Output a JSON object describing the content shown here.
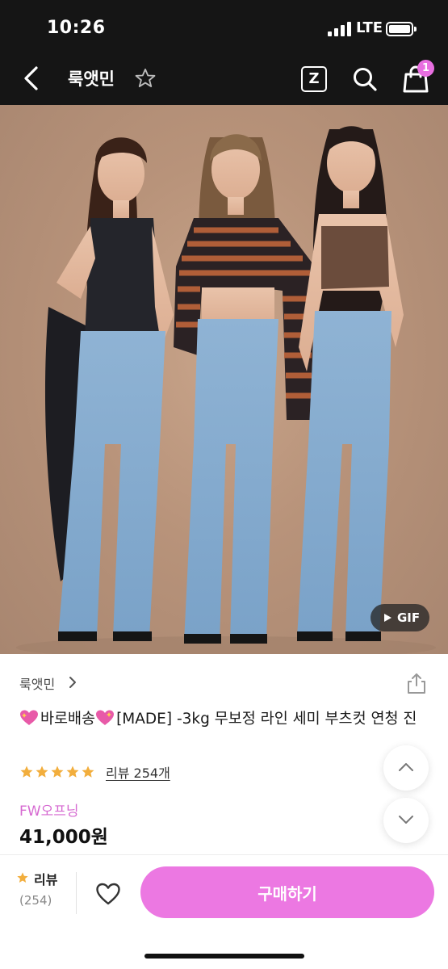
{
  "status_bar": {
    "time": "10:26",
    "network": "LTE",
    "icons": [
      "signal-icon",
      "battery-icon"
    ]
  },
  "header": {
    "back_icon": "chevron-left-icon",
    "title": "룩앳민",
    "favorite_icon": "star-outline-icon",
    "z_label": "Z",
    "search_icon": "search-icon",
    "cart_icon": "shopping-bag-icon",
    "cart_count": "1"
  },
  "product_image": {
    "gif_label": "GIF"
  },
  "product": {
    "brand": "룩앳민",
    "title_shipping": "바로배송",
    "title_rest": "[MADE] -3kg 무보정 라인 세미 부츠컷 연청 진",
    "rating_stars": 5,
    "review_link": "리뷰 254개",
    "promo": "FW오프닝",
    "price": "41,000원"
  },
  "bottom_bar": {
    "review_label": "리뷰",
    "review_count": "(254)",
    "buy_label": "구매하기"
  },
  "colors": {
    "accent": "#ec78e2",
    "promo": "#d66ad1",
    "star": "#f2ae3d",
    "header_bg": "#151515"
  }
}
